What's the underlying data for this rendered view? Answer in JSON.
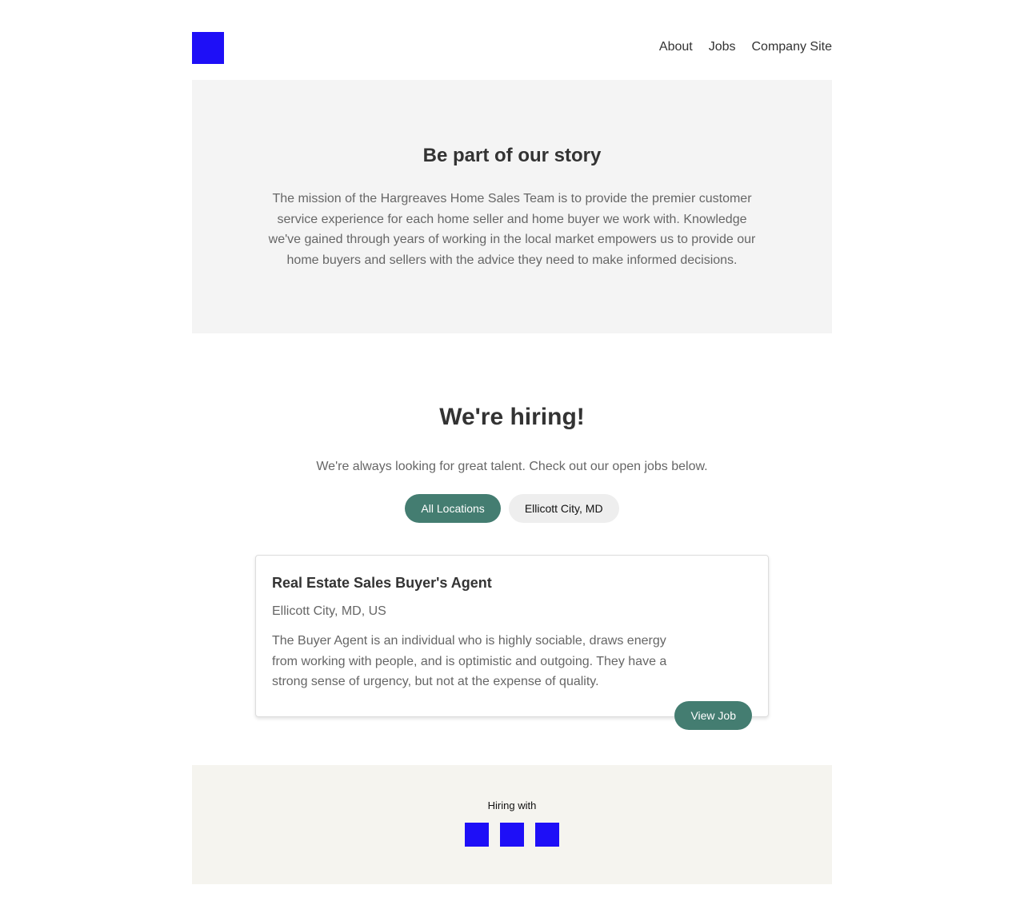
{
  "header": {
    "logo_color": "#1e0ff7",
    "nav": [
      {
        "label": "About"
      },
      {
        "label": "Jobs"
      },
      {
        "label": "Company Site"
      }
    ]
  },
  "story": {
    "title": "Be part of our story",
    "body": "The mission of the Hargreaves Home Sales Team is to provide the premier customer service experience for each home seller and home buyer we work with. Knowledge we've gained through years of working in the local market empowers us to provide our home buyers and sellers with the advice they need to make informed decisions."
  },
  "hiring": {
    "title": "We're hiring!",
    "lead": "We're always looking for great talent. Check out our open jobs below.",
    "filters": [
      {
        "label": "All Locations",
        "active": true
      },
      {
        "label": "Ellicott City, MD",
        "active": false
      }
    ]
  },
  "jobs": [
    {
      "title": "Real Estate Sales Buyer's Agent",
      "location": "Ellicott City, MD, US",
      "description": "The Buyer Agent is an individual who is highly sociable, draws energy from working with people, and is optimistic and outgoing. They have a strong sense of urgency, but not at the expense of quality.",
      "button_label": "View Job"
    }
  ],
  "footer": {
    "hiring_with": "Hiring with",
    "social_icons": [
      "social-icon-1",
      "social-icon-2",
      "social-icon-3"
    ]
  },
  "colors": {
    "accent": "#447d71",
    "placeholder_blue": "#1e0ff7",
    "story_bg": "#f4f4f4",
    "footer_bg": "#f5f4ef"
  }
}
